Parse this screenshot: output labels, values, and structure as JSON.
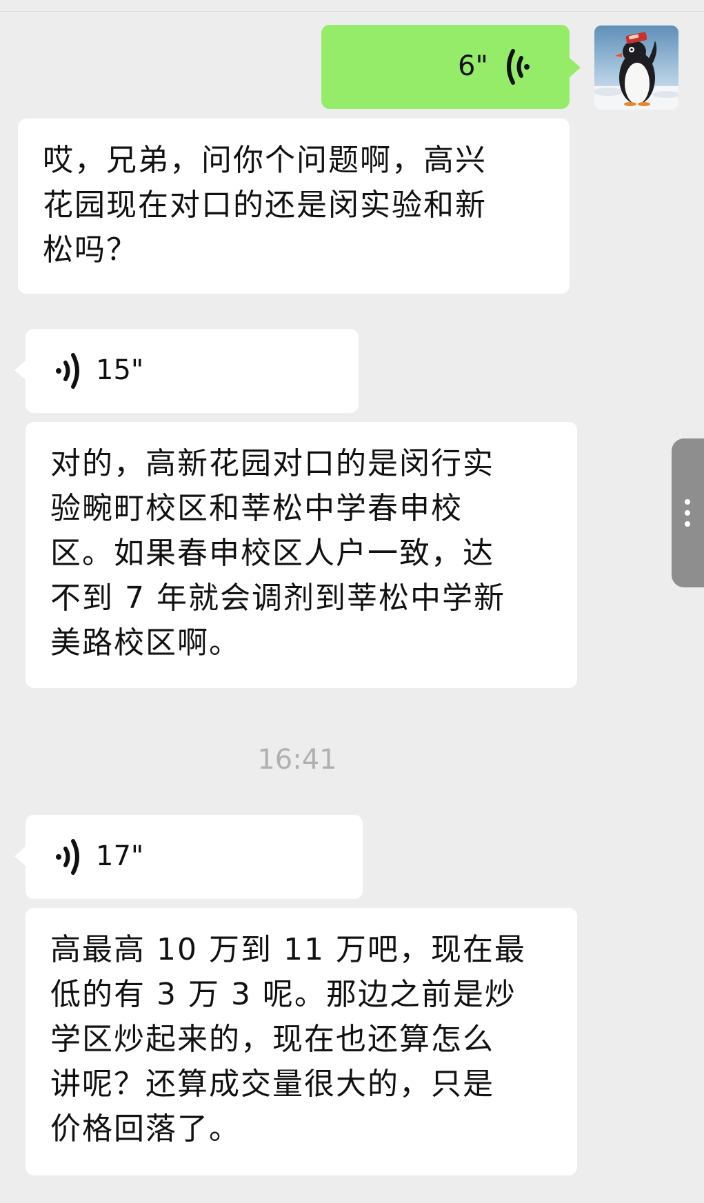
{
  "messages": [
    {
      "type": "voice",
      "direction": "outgoing",
      "duration": "6\""
    },
    {
      "type": "text",
      "direction": "outgoing",
      "text": "哎，兄弟，问你个问题啊，高兴\n花园现在对口的还是闵实验和新\n松吗？"
    },
    {
      "type": "voice",
      "direction": "incoming",
      "duration": "15\""
    },
    {
      "type": "text",
      "direction": "incoming",
      "text": "对的，高新花园对口的是闵行实\n验畹町校区和莘松中学春申校\n区。如果春申校区人户一致，达\n不到 7 年就会调剂到莘松中学新\n美路校区啊。"
    },
    {
      "type": "voice",
      "direction": "incoming",
      "duration": "17\""
    },
    {
      "type": "text",
      "direction": "incoming",
      "text": "高最高 10 万到 11 万吧，现在最\n低的有 3 万 3 呢。那边之前是炒\n学区炒起来的，现在也还算怎么\n讲呢？还算成交量很大的，只是\n价格回落了。"
    }
  ],
  "timestamp": "16:41",
  "colors": {
    "background": "#ededed",
    "outgoing_bubble": "#95ec69",
    "incoming_bubble": "#ffffff",
    "timestamp_text": "#b0b0b0"
  },
  "icons": {
    "avatar": "penguin-avatar",
    "voice_outgoing": "voice-wave-icon",
    "voice_incoming": "voice-wave-icon",
    "side_handle": "more-vertical-icon"
  }
}
